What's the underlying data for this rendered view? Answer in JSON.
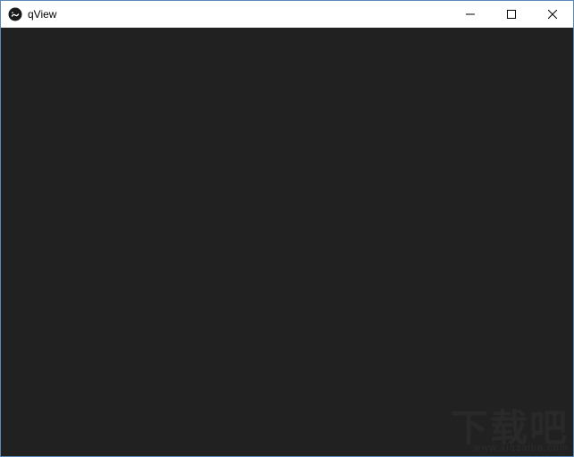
{
  "window": {
    "title": "qView",
    "icon": "qview-app-icon"
  },
  "controls": {
    "minimize": "minimize",
    "maximize": "maximize",
    "close": "close"
  },
  "content": {
    "background_color": "#212121"
  },
  "watermark": {
    "main": "下载吧",
    "sub": "www.xiazaiba.com"
  }
}
